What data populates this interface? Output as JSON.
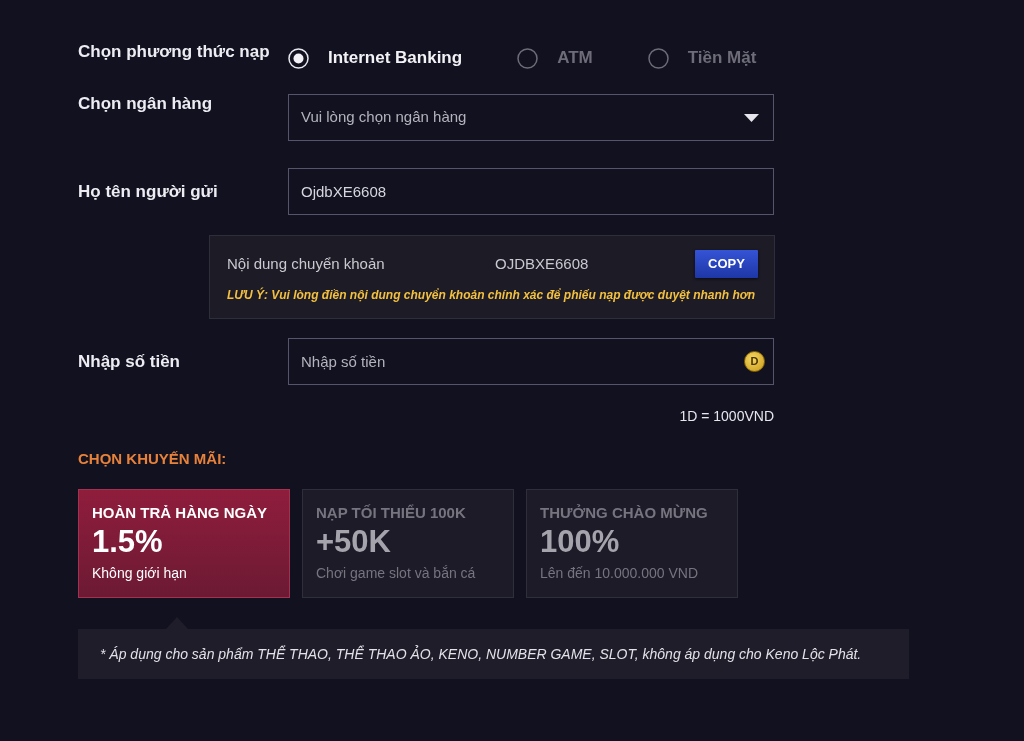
{
  "deposit_method": {
    "label": "Chọn phương thức nạp",
    "options": [
      {
        "label": "Internet Banking",
        "selected": true
      },
      {
        "label": "ATM",
        "selected": false
      },
      {
        "label": "Tiền Mặt",
        "selected": false
      }
    ]
  },
  "bank": {
    "label": "Chọn ngân hàng",
    "placeholder": "Vui lòng chọn ngân hàng"
  },
  "sender_name": {
    "label": "Họ tên người gửi",
    "value": "OjdbXE6608"
  },
  "transfer_content": {
    "label": "Nội dung chuyển khoản",
    "code": "OJDBXE6608",
    "copy_button": "COPY",
    "note": "LƯU Ý: Vui lòng điền nội dung chuyển khoản chính xác để phiếu nạp được duyệt nhanh hơn"
  },
  "amount": {
    "label": "Nhập số tiền",
    "placeholder": "Nhập số tiền",
    "coin_symbol": "D",
    "rate": "1D = 1000VND"
  },
  "promotions": {
    "heading": "CHỌN KHUYẾN MÃI:",
    "items": [
      {
        "title": "HOÀN TRẢ HÀNG NGÀY",
        "value": "1.5%",
        "subtitle": "Không giới hạn",
        "selected": true
      },
      {
        "title": "NẠP TỐI THIỂU 100K",
        "value": "+50K",
        "subtitle": "Chơi game slot và bắn cá",
        "selected": false
      },
      {
        "title": "THƯỞNG CHÀO MỪNG",
        "value": "100%",
        "subtitle": "Lên đến 10.000.000 VND",
        "selected": false
      }
    ],
    "footnote": "* Áp dụng cho sản phẩm THỂ THAO, THỂ THAO ẢO, KENO, NUMBER GAME, SLOT, không áp dụng cho Keno Lộc Phát."
  }
}
